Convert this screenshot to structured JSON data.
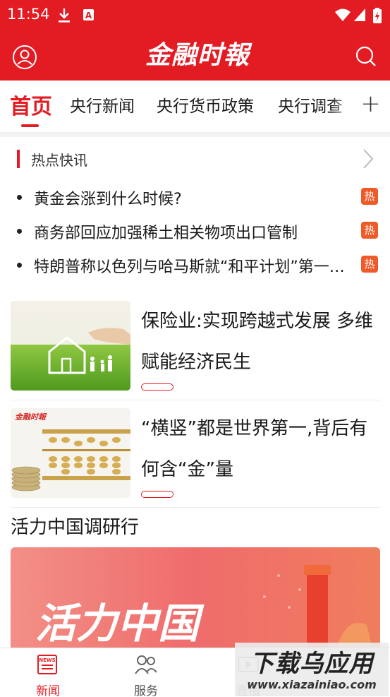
{
  "status_bar": {
    "time": "11:54",
    "icons": [
      "download-icon",
      "a-notification-icon",
      "wifi-icon",
      "signal-icon",
      "battery-icon"
    ]
  },
  "header": {
    "logo_text": "金融时報",
    "icons": [
      "user-icon",
      "search-icon"
    ]
  },
  "tabs": {
    "items": [
      {
        "label": "首页",
        "active": true
      },
      {
        "label": "央行新闻",
        "active": false
      },
      {
        "label": "央行货币政策",
        "active": false
      },
      {
        "label": "央行调查",
        "active": false
      }
    ],
    "more_icon": "plus-icon"
  },
  "hot_news": {
    "title": "热点快讯",
    "badge": "热",
    "items": [
      {
        "text": "黄金会涨到什么时候?"
      },
      {
        "text": "商务部回应加强稀土相关物项出口管制"
      },
      {
        "text": "特朗普称以色列与哈马斯就“和平计划”第一阶段达成一致"
      }
    ]
  },
  "articles": [
    {
      "title": "保险业:实现跨越式发展 多维赋能经济民生",
      "thumb": "house-hand-grass-image"
    },
    {
      "title": "“横竖”都是世界第一,背后有何含“金”量",
      "thumb": "abacus-coins-image",
      "thumb_logo": "金融时報"
    }
  ],
  "section": {
    "title": "活力中国调研行",
    "banner_text": "活力中国"
  },
  "bottom_nav": {
    "items": [
      {
        "label": "新闻",
        "icon": "news-icon",
        "active": true
      },
      {
        "label": "服务",
        "icon": "people-icon",
        "active": false
      },
      {
        "label": "直播",
        "icon": "live-icon",
        "active": false
      }
    ],
    "news_icon_text": "NEWS"
  },
  "watermark": {
    "title": "下载乌应用",
    "url": "www.xiazainiao.com"
  },
  "colors": {
    "brand_red": "#e31b23",
    "hot_badge": "#f05a28"
  }
}
